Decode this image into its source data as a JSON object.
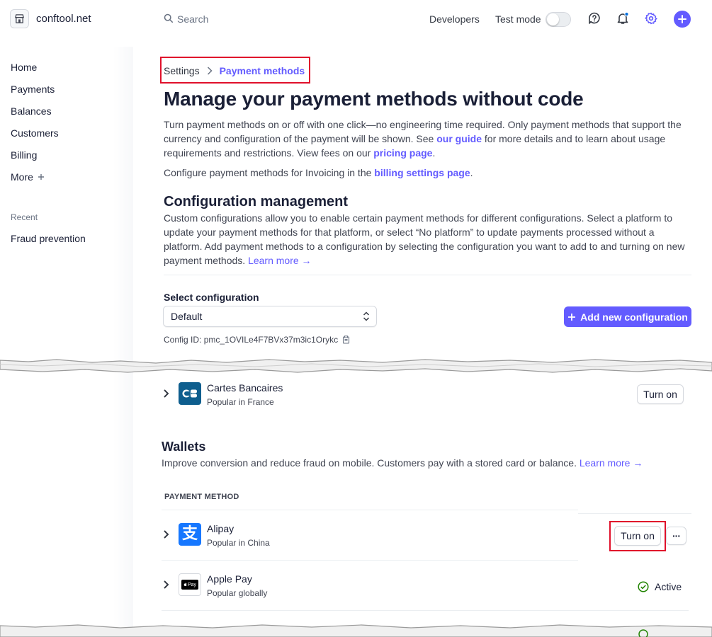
{
  "topbar": {
    "account_name": "conftool.net",
    "search_placeholder": "Search",
    "developers_label": "Developers",
    "test_mode_label": "Test mode"
  },
  "sidebar": {
    "items": [
      {
        "label": "Home"
      },
      {
        "label": "Payments"
      },
      {
        "label": "Balances"
      },
      {
        "label": "Customers"
      },
      {
        "label": "Billing"
      },
      {
        "label": "More"
      }
    ],
    "recent_label": "Recent",
    "recent_items": [
      {
        "label": "Fraud prevention"
      }
    ]
  },
  "breadcrumb": {
    "parent": "Settings",
    "current": "Payment methods"
  },
  "page": {
    "title": "Manage your payment methods without code",
    "intro_1": "Turn payment methods on or off with one click—no engineering time required. Only payment methods that support the currency and configuration of the payment will be shown. See ",
    "intro_link_guide": "our guide",
    "intro_2": " for more details and to learn about usage requirements and restrictions. View fees on our ",
    "intro_link_pricing": "pricing page",
    "intro_3": ".",
    "invoicing_1": "Configure payment methods for Invoicing in the ",
    "invoicing_link": "billing settings page",
    "invoicing_2": "."
  },
  "config": {
    "heading": "Configuration management",
    "description": "Custom configurations allow you to enable certain payment methods for different configurations. Select a platform to update your payment methods for that platform, or select “No platform” to update payments processed without a platform. Add payment methods to a configuration by selecting the configuration you want to add to and turning on new payment methods. ",
    "learn_more": "Learn more →",
    "select_label": "Select configuration",
    "select_value": "Default",
    "add_button": "Add new configuration",
    "config_id": "Config ID: pmc_1OVILe4F7BVx37m3ic1Orykc"
  },
  "cards": {
    "cartes_bancaires": {
      "name": "Cartes Bancaires",
      "sub": "Popular in France",
      "button": "Turn on"
    }
  },
  "wallets": {
    "heading": "Wallets",
    "description": "Improve conversion and reduce fraud on mobile. Customers pay with a stored card or balance. ",
    "learn_more": "Learn more →",
    "column_header": "PAYMENT METHOD",
    "alipay": {
      "name": "Alipay",
      "sub": "Popular in China",
      "button": "Turn on",
      "more": "···"
    },
    "apple_pay": {
      "name": "Apple Pay",
      "sub": "Popular globally",
      "status": "Active",
      "logo_text": "Pay"
    }
  },
  "colors": {
    "accent": "#635bff",
    "highlight": "#e0102b",
    "success": "#228403"
  }
}
